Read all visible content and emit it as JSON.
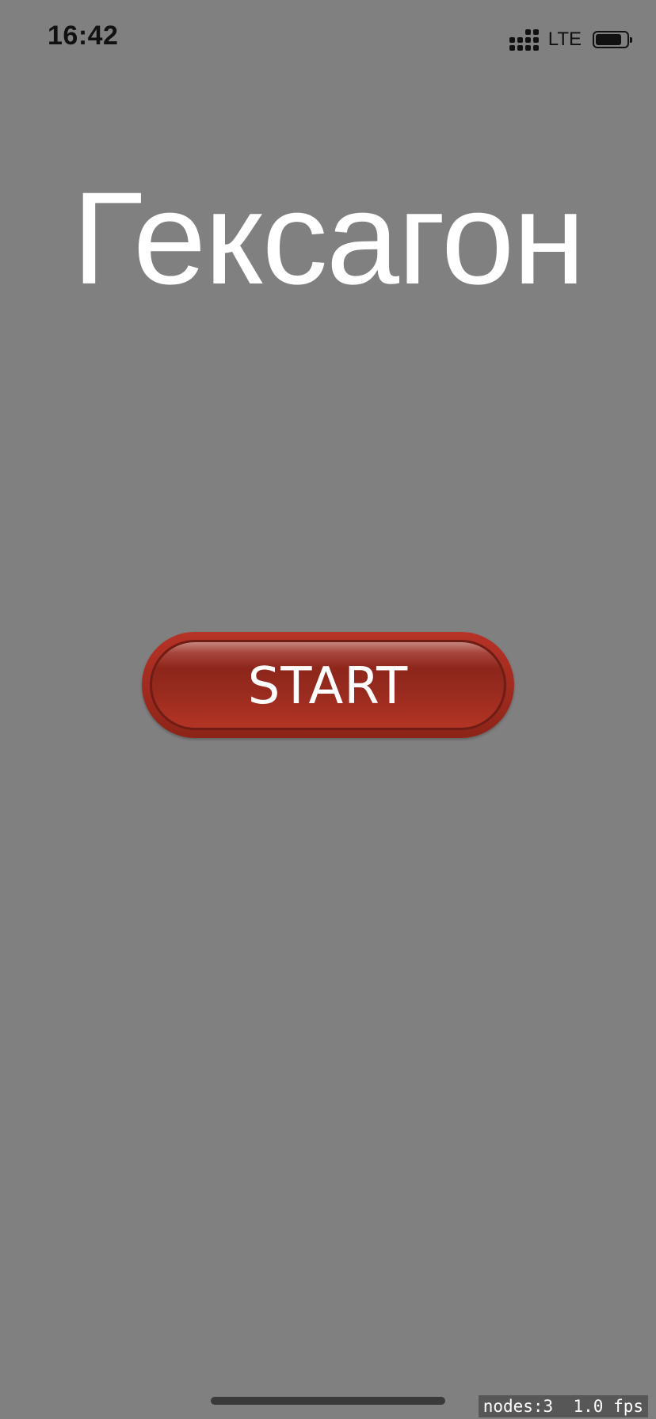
{
  "status_bar": {
    "time": "16:42",
    "network": "LTE",
    "signal_bars_filled": 4,
    "battery_level": 0.85,
    "icons": [
      "signal-icon",
      "battery-icon"
    ]
  },
  "main": {
    "title": "Гексагон",
    "start_button_label": "START",
    "start_button_color": "#a32b1f"
  },
  "colors": {
    "background": "#808080",
    "title_text": "#ffffff"
  },
  "debug": {
    "stats": "nodes:3  1.0 fps"
  }
}
